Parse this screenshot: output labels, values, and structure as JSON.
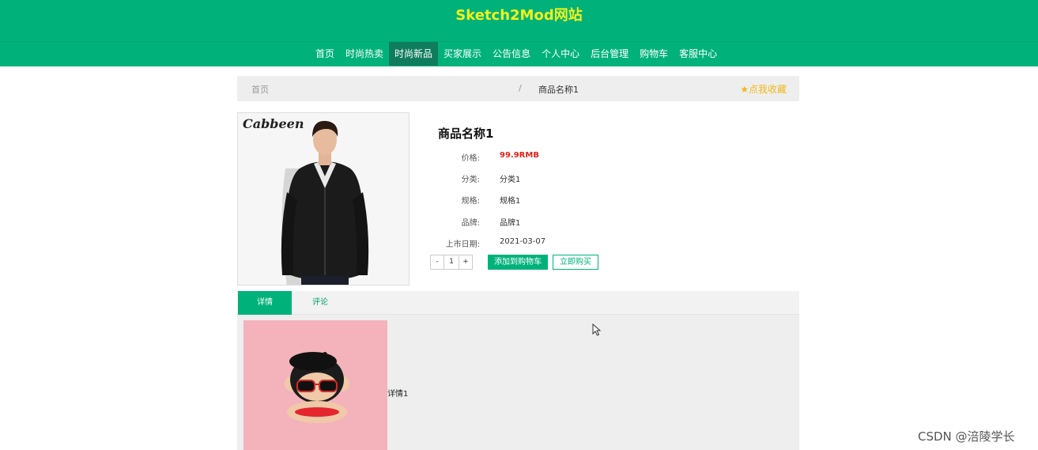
{
  "site": {
    "title": "Sketch2Mod网站"
  },
  "nav": {
    "items": [
      {
        "label": "首页"
      },
      {
        "label": "时尚热卖"
      },
      {
        "label": "时尚新品"
      },
      {
        "label": "买家展示"
      },
      {
        "label": "公告信息"
      },
      {
        "label": "个人中心"
      },
      {
        "label": "后台管理"
      },
      {
        "label": "购物车"
      },
      {
        "label": "客服中心"
      }
    ],
    "active_index": 2
  },
  "breadcrumb": {
    "home": "首页",
    "separator": "/",
    "current": "商品名称1",
    "favorite": "点我收藏"
  },
  "product": {
    "brand_logo_text": "Cabbeen",
    "name": "商品名称1",
    "fields": [
      {
        "label": "价格:",
        "value": "99.9RMB"
      },
      {
        "label": "分类:",
        "value": "分类1"
      },
      {
        "label": "规格:",
        "value": "规格1"
      },
      {
        "label": "品牌:",
        "value": "品牌1"
      },
      {
        "label": "上市日期:",
        "value": "2021-03-07"
      }
    ],
    "quantity": {
      "minus": "-",
      "value": "1",
      "plus": "+"
    },
    "add_to_cart": "添加到购物车",
    "buy_now": "立即购买"
  },
  "tabs": [
    {
      "label": "详情"
    },
    {
      "label": "评论"
    }
  ],
  "detail": {
    "text": "详情1"
  },
  "watermark": "CSDN @涪陵学长",
  "colors": {
    "primary": "#00b27a",
    "title": "#f2f21a",
    "price": "#e2231a",
    "favorite": "#f0b81c"
  }
}
